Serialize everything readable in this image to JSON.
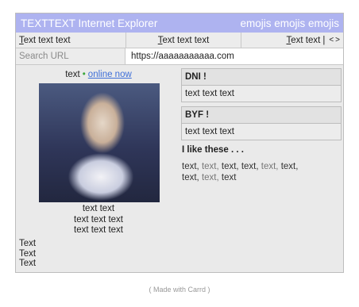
{
  "window": {
    "title": "TEXTTEXT Internet Explorer",
    "title_right": "emojis emojis emojis"
  },
  "menubar": {
    "item1": "Text text text",
    "item2": "Text text text",
    "item3": "Text text",
    "nav_separator": "|",
    "back": "<",
    "forward": ">"
  },
  "urlbar": {
    "label": "Search URL",
    "value": "https://aaaaaaaaaaa.com"
  },
  "profile": {
    "status_text": "text",
    "status_dot": "•",
    "online_link": "online now",
    "caption": [
      "text text",
      "text text text",
      "text text text"
    ],
    "side_text": [
      "Text",
      "Text",
      "Text"
    ]
  },
  "boxes": [
    {
      "title": "DNI !",
      "body": "text text text"
    },
    {
      "title": "BYF !",
      "body": "text text text"
    }
  ],
  "likes": {
    "heading": "I like these . . .",
    "items": [
      "text,",
      "text,",
      "text,",
      "text,",
      "text,",
      "text,",
      "text,",
      "text,",
      "text"
    ]
  },
  "footer": "( Made with Carrd )",
  "colors": {
    "titlebar": "#aeb3f0",
    "link": "#3d6ed8",
    "online_dot": "#3aa63a"
  }
}
